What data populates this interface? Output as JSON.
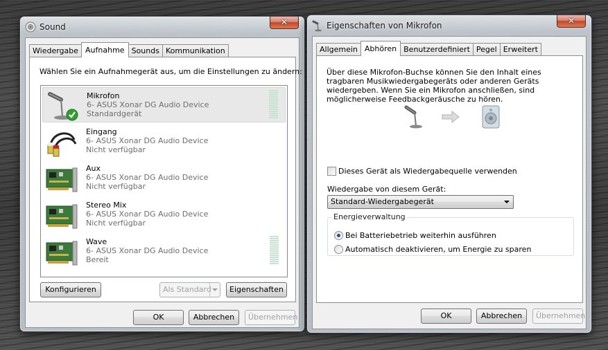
{
  "sound_window": {
    "title": "Sound",
    "close_label": "✕",
    "tabs": [
      {
        "label": "Wiedergabe",
        "active": false
      },
      {
        "label": "Aufnahme",
        "active": true
      },
      {
        "label": "Sounds",
        "active": false
      },
      {
        "label": "Kommunikation",
        "active": false
      }
    ],
    "instruction": "Wählen Sie ein Aufnahmegerät aus, um die Einstellungen zu ändern:",
    "devices": [
      {
        "name": "Mikrofon",
        "driver": "6- ASUS Xonar DG Audio Device",
        "status": "Standardgerät",
        "icon": "microphone-icon",
        "selected": true,
        "level_meter": true
      },
      {
        "name": "Eingang",
        "driver": "6- ASUS Xonar DG Audio Device",
        "status": "Nicht verfügbar",
        "icon": "rca-cable-icon",
        "selected": false,
        "level_meter": false
      },
      {
        "name": "Aux",
        "driver": "6- ASUS Xonar DG Audio Device",
        "status": "Nicht verfügbar",
        "icon": "sound-card-icon",
        "selected": false,
        "level_meter": false
      },
      {
        "name": "Stereo Mix",
        "driver": "6- ASUS Xonar DG Audio Device",
        "status": "Nicht verfügbar",
        "icon": "sound-card-icon",
        "selected": false,
        "level_meter": false
      },
      {
        "name": "Wave",
        "driver": "6- ASUS Xonar DG Audio Device",
        "status": "Bereit",
        "icon": "sound-card-icon",
        "selected": false,
        "level_meter": true
      }
    ],
    "buttons": {
      "configure": "Konfigurieren",
      "set_default": "Als Standard",
      "properties": "Eigenschaften",
      "ok": "OK",
      "cancel": "Abbrechen",
      "apply": "Übernehmen"
    }
  },
  "properties_window": {
    "title": "Eigenschaften von Mikrofon",
    "close_label": "✕",
    "tabs": [
      {
        "label": "Allgemein",
        "active": false
      },
      {
        "label": "Abhören",
        "active": true
      },
      {
        "label": "Benutzerdefiniert",
        "active": false
      },
      {
        "label": "Pegel",
        "active": false
      },
      {
        "label": "Erweitert",
        "active": false
      }
    ],
    "description": "Über diese Mikrofon-Buchse können Sie den Inhalt eines tragbaren Musikwiedergabegeräts oder anderen Geräts wiedergeben. Wenn Sie ein Mikrofon anschließen, sind möglicherweise Feedbackgeräusche zu hören.",
    "listen_checkbox": {
      "label": "Dieses Gerät als Wiedergabequelle verwenden",
      "checked": false
    },
    "playback_label": "Wiedergabe von diesem Gerät:",
    "playback_select": "Standard-Wiedergabegerät",
    "power_group": {
      "legend": "Energieverwaltung",
      "options": [
        {
          "label": "Bei Batteriebetrieb weiterhin ausführen",
          "selected": true
        },
        {
          "label": "Automatisch deaktivieren, um Energie zu sparen",
          "selected": false
        }
      ]
    },
    "buttons": {
      "ok": "OK",
      "cancel": "Abbrechen",
      "apply": "Übernehmen"
    }
  },
  "colors": {
    "selection_bg": "#e8e8e8",
    "check_green": "#2fa12f",
    "meter_green": "#c7e2d0"
  }
}
